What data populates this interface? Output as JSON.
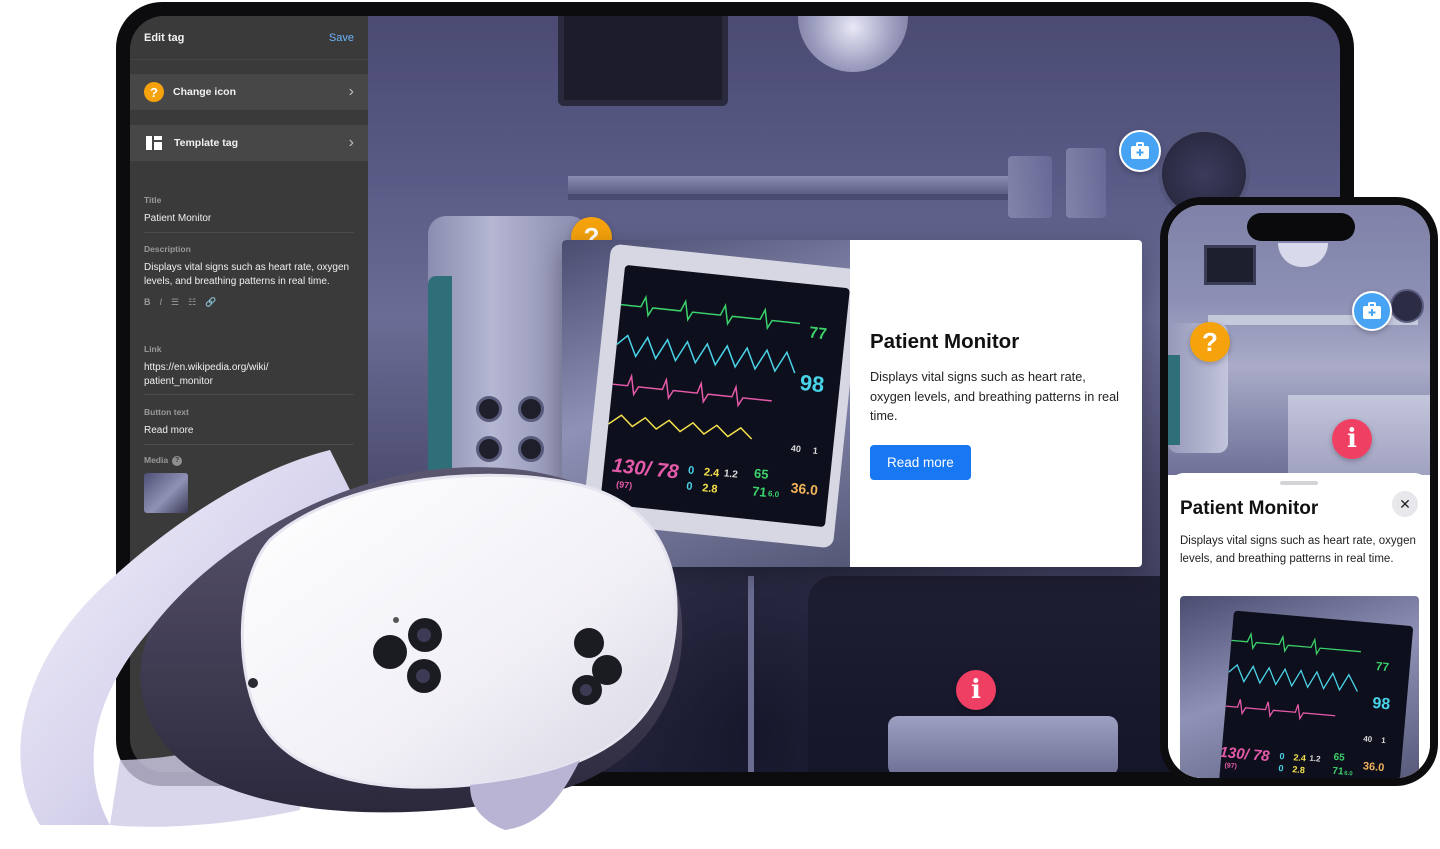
{
  "editor": {
    "header_title": "Edit tag",
    "save_label": "Save",
    "change_icon_label": "Change icon",
    "template_tag_label": "Template tag",
    "title_label": "Title",
    "title_value": "Patient Monitor",
    "description_label": "Description",
    "description_value": "Displays vital signs such as heart rate, oxygen levels, and breathing patterns in real time.",
    "toolbar": {
      "bold": "B",
      "italic": "I",
      "bullets": "☰",
      "numbers": "☷",
      "link": "🔗"
    },
    "link_label": "Link",
    "link_value_line1": "https://en.wikipedia.org/wiki/",
    "link_value_line2": "patient_monitor",
    "button_text_label": "Button text",
    "button_text_value": "Read more",
    "media_label": "Media"
  },
  "hotspots": {
    "question_glyph": "?",
    "info_glyph": "i",
    "medical_glyph": "+"
  },
  "popup": {
    "title": "Patient Monitor",
    "description": "Displays vital signs such as heart rate, oxygen levels, and breathing patterns in real time.",
    "button_label": "Read more"
  },
  "monitor_readout": {
    "bp": "130/ 78",
    "bp_mean": "(97)",
    "hr": "77",
    "spo2": "98",
    "resp_a": "2.4",
    "resp_b": "1.2",
    "resp_c": "2.8",
    "zero_a": "0",
    "zero_b": "0",
    "pulse": "65",
    "rate": "71",
    "rate_dec": "6.0",
    "temp": "36.0",
    "small_a": "40",
    "small_b": "1"
  },
  "phone": {
    "sheet_title": "Patient Monitor",
    "sheet_description": "Displays vital signs such as heart rate, oxygen levels, and breathing patterns in real time.",
    "close_glyph": "✕"
  },
  "colors": {
    "accent_blue": "#1877f2",
    "hotspot_question": "#f5a20c",
    "hotspot_info": "#ef3f63",
    "hotspot_medical": "#47a3f3",
    "editor_panel": "#3a3a3a"
  }
}
